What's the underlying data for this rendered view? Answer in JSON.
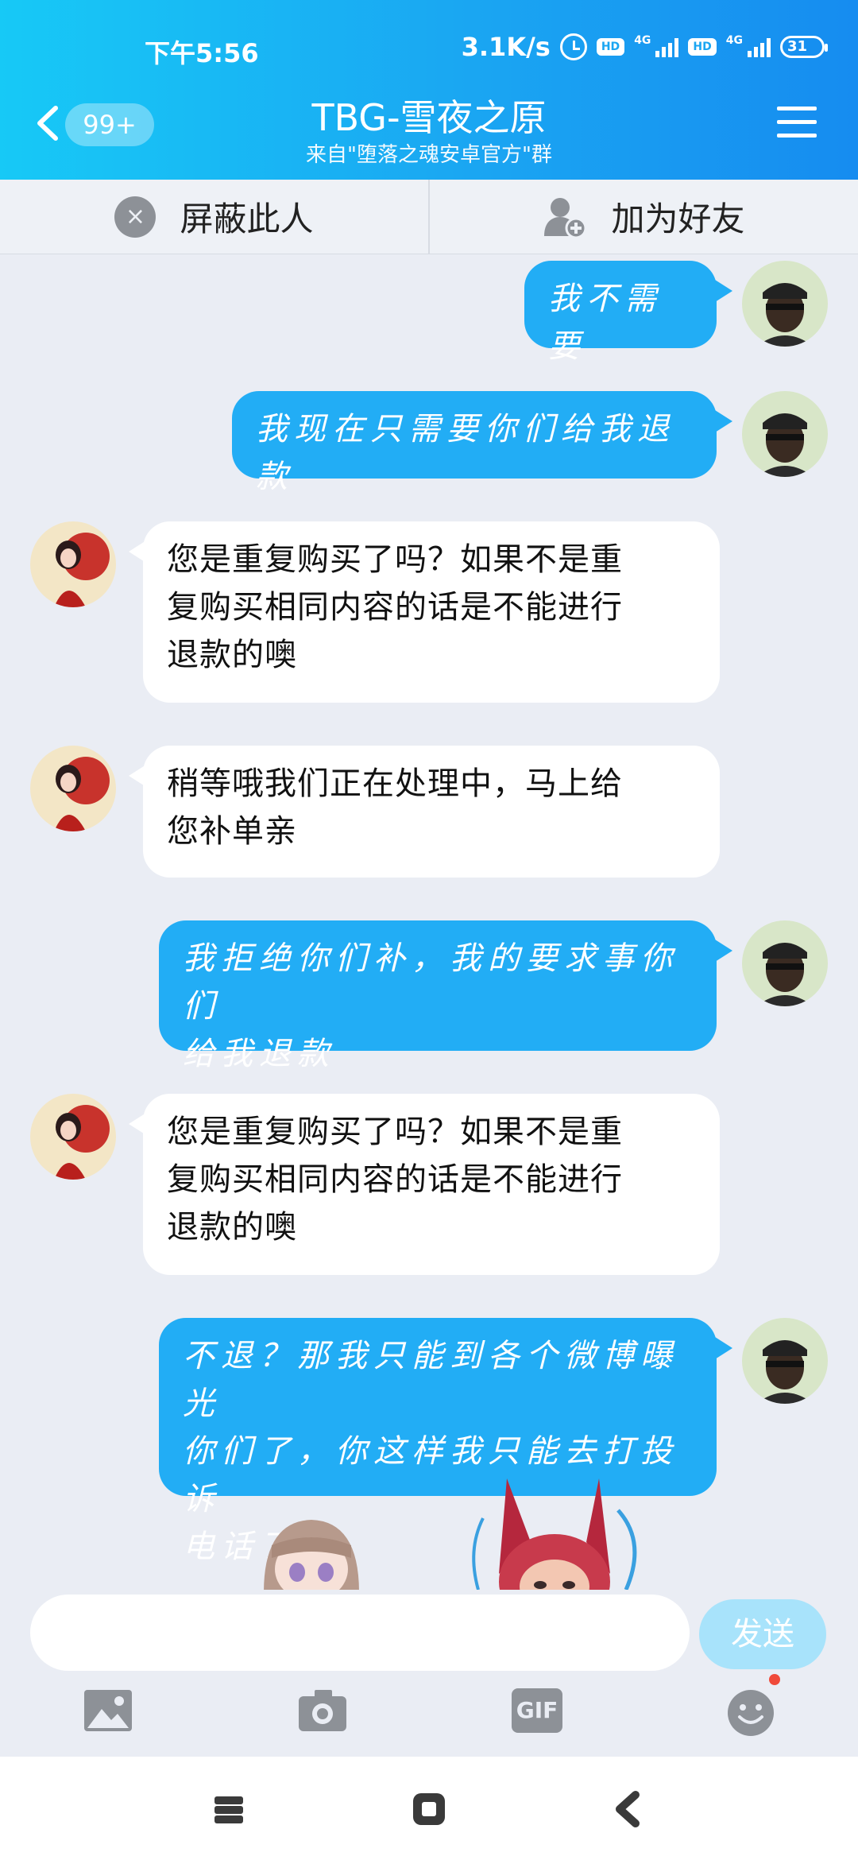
{
  "status_bar": {
    "time": "下午5:56",
    "net_speed": "3.1K/s",
    "hd1": "HD",
    "sim1": "4G",
    "hd2": "HD",
    "sim2": "4G",
    "battery": "31"
  },
  "header": {
    "unread_count": "99+",
    "title": "TBG-雪夜之原",
    "subtitle": "来自\"堕落之魂安卓官方\"群"
  },
  "actions": {
    "block_label": "屏蔽此人",
    "add_friend_label": "加为好友"
  },
  "messages": [
    {
      "side": "sent",
      "lines": [
        "我不需要"
      ]
    },
    {
      "side": "sent",
      "lines": [
        "我现在只需要你们给我退款"
      ]
    },
    {
      "side": "recv",
      "lines": [
        "您是重复购买了吗？如果不是重",
        "复购买相同内容的话是不能进行",
        "退款的噢"
      ]
    },
    {
      "side": "recv",
      "lines": [
        "稍等哦我们正在处理中，马上给",
        "您补单亲"
      ]
    },
    {
      "side": "sent",
      "lines": [
        "我拒绝你们补，我的要求事你们",
        "给我退款"
      ]
    },
    {
      "side": "recv",
      "lines": [
        "您是重复购买了吗？如果不是重",
        "复购买相同内容的话是不能进行",
        "退款的噢"
      ]
    },
    {
      "side": "sent",
      "lines": [
        "不退？那我只能到各个微博曝光",
        "你们了，你这样我只能去打投诉",
        "电话了"
      ]
    }
  ],
  "input": {
    "value": "",
    "placeholder": "",
    "send_label": "发送"
  },
  "toolbar": {
    "gif_label": "GIF"
  },
  "colors": {
    "header_start": "#17c9f6",
    "header_end": "#168cf0",
    "sent_bubble": "#22adf5",
    "recv_bubble": "#ffffff",
    "background": "#eaedf4",
    "send_button": "#a8e3fb"
  }
}
